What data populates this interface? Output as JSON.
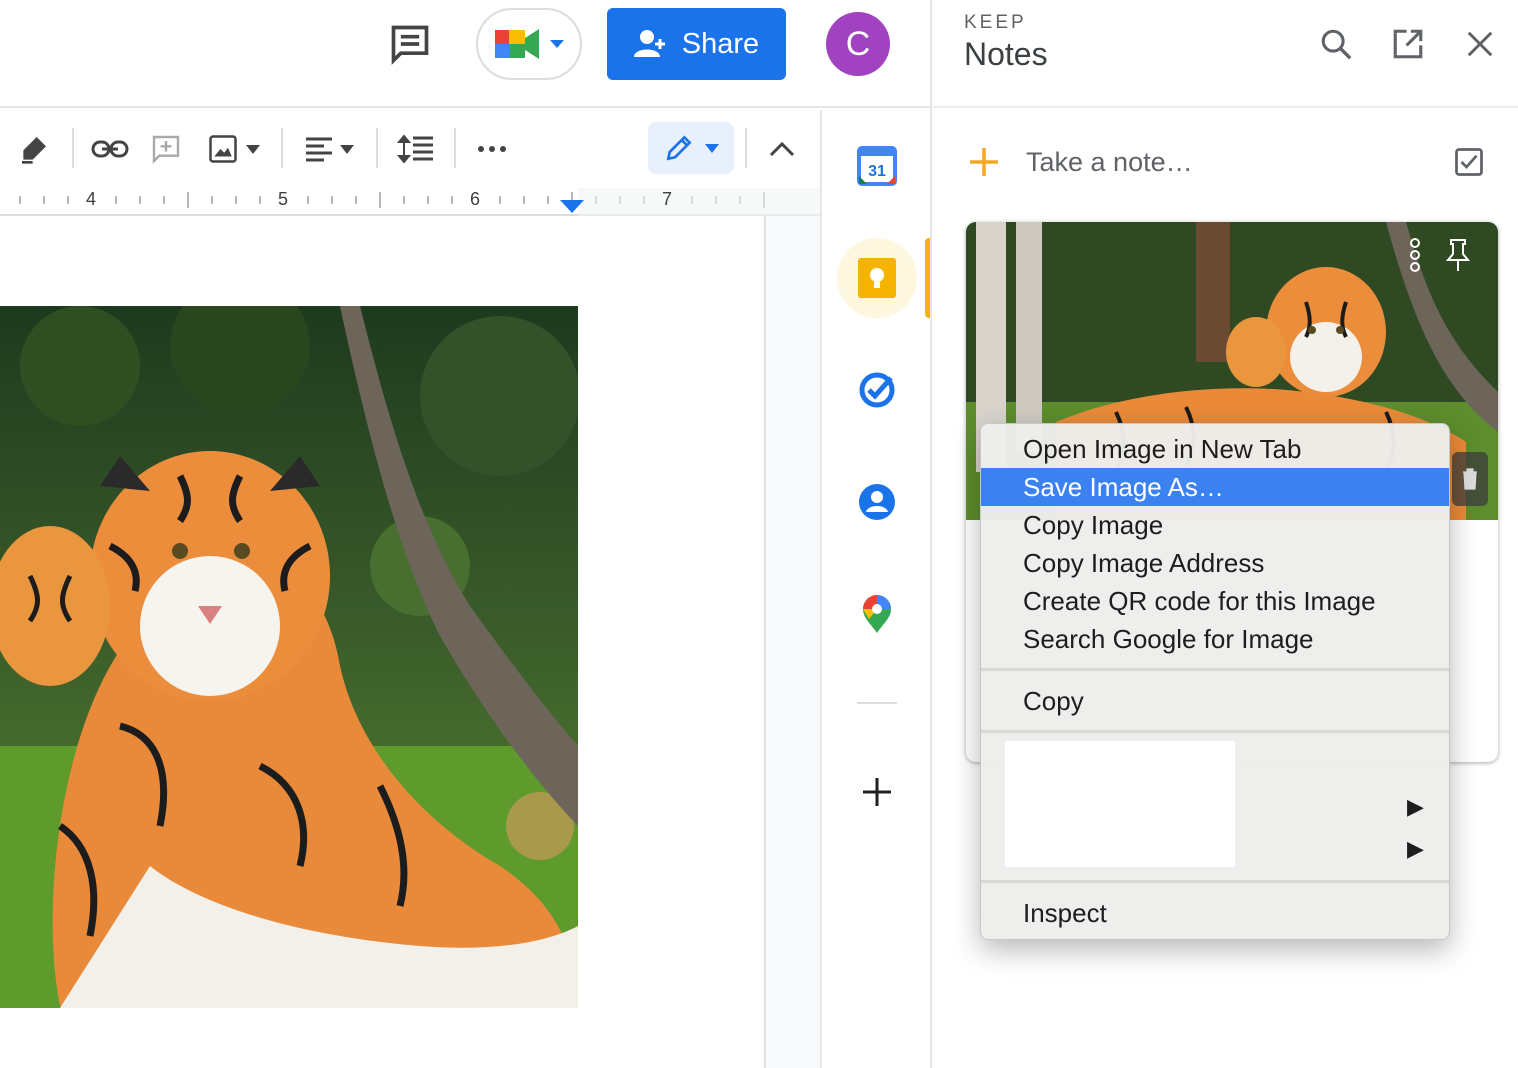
{
  "header": {
    "share_label": "Share",
    "avatar_initial": "C"
  },
  "ruler": {
    "numbers": [
      "4",
      "5",
      "6",
      "7"
    ]
  },
  "side_apps": [
    "calendar",
    "keep",
    "tasks",
    "contacts",
    "maps",
    "add"
  ],
  "calendar_day": "31",
  "keep": {
    "brand_small": "KEEP",
    "title": "Notes",
    "take_note_placeholder": "Take a note…"
  },
  "context_menu": {
    "items": [
      "Open Image in New Tab",
      "Save Image As…",
      "Copy Image",
      "Copy Image Address",
      "Create QR code for this Image",
      "Search Google for Image"
    ],
    "highlighted_index": 1,
    "copy": "Copy",
    "inspect": "Inspect"
  },
  "colors": {
    "share_blue": "#1a73e8",
    "avatar_purple": "#a142c0",
    "keep_yellow": "#f5b400",
    "menu_highlight": "#3b82f0"
  }
}
